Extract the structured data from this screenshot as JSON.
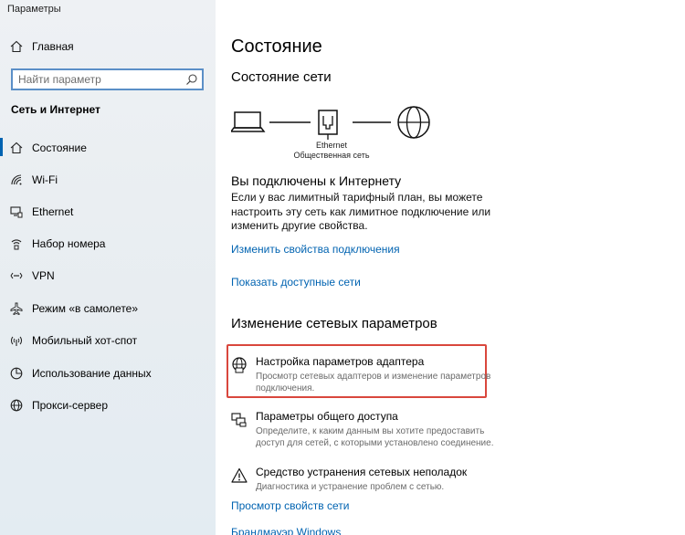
{
  "window": {
    "title": "Параметры"
  },
  "sidebar": {
    "home_label": "Главная",
    "search_placeholder": "Найти параметр",
    "section_title": "Сеть и Интернет",
    "items": [
      {
        "label": "Состояние",
        "icon": "home-status-icon",
        "active": true
      },
      {
        "label": "Wi-Fi",
        "icon": "wifi-icon",
        "active": false
      },
      {
        "label": "Ethernet",
        "icon": "ethernet-icon",
        "active": false
      },
      {
        "label": "Набор номера",
        "icon": "dialup-icon",
        "active": false
      },
      {
        "label": "VPN",
        "icon": "vpn-icon",
        "active": false
      },
      {
        "label": "Режим «в самолете»",
        "icon": "airplane-icon",
        "active": false
      },
      {
        "label": "Мобильный хот-спот",
        "icon": "hotspot-icon",
        "active": false
      },
      {
        "label": "Использование данных",
        "icon": "data-usage-icon",
        "active": false
      },
      {
        "label": "Прокси-сервер",
        "icon": "globe-icon",
        "active": false
      }
    ]
  },
  "main": {
    "title": "Состояние",
    "network_status_title": "Состояние сети",
    "network": {
      "name": "Ethernet",
      "type": "Общественная сеть"
    },
    "connected_title": "Вы подключены к Интернету",
    "connected_desc": "Если у вас лимитный тарифный план, вы можете настроить эту сеть как лимитное подключение или изменить другие свойства.",
    "link_change_props": "Изменить свойства подключения",
    "link_show_networks": "Показать доступные сети",
    "change_title": "Изменение сетевых параметров",
    "options": [
      {
        "title": "Настройка параметров адаптера",
        "desc": "Просмотр сетевых адаптеров и изменение параметров подключения.",
        "icon": "adapter-globe-icon"
      },
      {
        "title": "Параметры общего доступа",
        "desc": "Определите, к каким данным вы хотите предоставить доступ для сетей, с которыми установлено соединение.",
        "icon": "sharing-icon"
      },
      {
        "title": "Средство устранения сетевых неполадок",
        "desc": "Диагностика и устранение проблем с сетью.",
        "icon": "warning-icon"
      }
    ],
    "link_view_props": "Просмотр свойств сети",
    "link_firewall": "Брандмауэр Windows"
  },
  "colors": {
    "accent": "#0063b1",
    "highlight": "#d9473d"
  }
}
